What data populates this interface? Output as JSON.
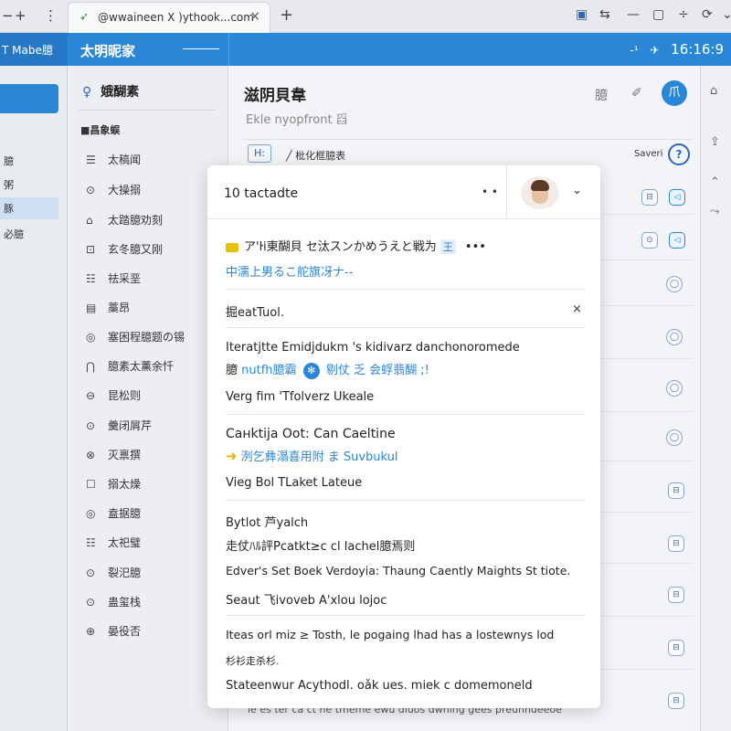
{
  "browser": {
    "tab_title": "@wwaineen  X )ythook...com",
    "tab_close": "×",
    "new_tab": "+",
    "left_controls": [
      "−",
      "+",
      "⋮"
    ],
    "window_controls": [
      "▣",
      "⇆",
      "—",
      "▢",
      "÷",
      "⟳",
      "⌄"
    ]
  },
  "appbar": {
    "left_label": "T Mabe臆",
    "brand": "太明昵家",
    "right_time": "16:16:9",
    "right_icons": [
      "-¹",
      "✈"
    ]
  },
  "farleft": {
    "items": [
      "臆",
      "粥",
      "豚",
      "必臆"
    ],
    "selected_index": 2
  },
  "sidebar": {
    "header": "娥醐素",
    "section": "■昌象蜈",
    "items": [
      {
        "icon": "☰",
        "label": "太稿闻"
      },
      {
        "icon": "⊙",
        "label": "大操搦"
      },
      {
        "icon": "⌂",
        "label": "太踏臆劝刻"
      },
      {
        "icon": "⊡",
        "label": "玄冬臆又刚"
      },
      {
        "icon": "☷",
        "label": "祛采垩"
      },
      {
        "icon": "▤",
        "label": "藁昂"
      },
      {
        "icon": "◎",
        "label": "塞困程臆题の锡"
      },
      {
        "icon": "⋂",
        "label": "臆素太薰余忏"
      },
      {
        "icon": "⊖",
        "label": "昆松则"
      },
      {
        "icon": "⊙",
        "label": "羹闭屑芹"
      },
      {
        "icon": "⊗",
        "label": "灭禀撰"
      },
      {
        "icon": "☐",
        "label": "搦太燥"
      },
      {
        "icon": "◎",
        "label": "盍据臆"
      },
      {
        "icon": "☷",
        "label": "太祀璧"
      },
      {
        "icon": "⊙",
        "label": "裂汜臆"
      },
      {
        "icon": "⊙",
        "label": "蛊玺栈"
      },
      {
        "icon": "⊕",
        "label": "晏役否"
      }
    ]
  },
  "main": {
    "title": "滋阴貝韋",
    "subtitle": "Ekle nyopfront 舀",
    "header_icons": [
      "臆",
      "✐"
    ],
    "avatar_letter": "爪",
    "crumb_box": "H:",
    "crumb": "╱  枇化框臆表",
    "saved": "Saveri",
    "help": "?",
    "bottom_text": "ie es  ter  ca  ct he  tmeme ewu  diuos dwning   gees  preunndeeoe"
  },
  "card": {
    "title": "10 tactadte",
    "dots": "• •",
    "chevron": "⌄",
    "row1_text": "ア'ŀi東醐貝 セ汰スンかめうえと戦为",
    "row1_chip": "王",
    "row1_dots": "•••",
    "row1_link": "中濡上男るこ舵旗冴ナ--",
    "section1_label": "掘eatTuol.",
    "close": "×",
    "item1_line1": "Iteratjtte Emidjdukm 's kidivarz danchonoromede",
    "item1_line2_pre": "臆",
    "item1_line2_link": "nutfh臆霸",
    "item1_line2_rest": "剔仗 乏 会蜉翡醐 ;!",
    "item1_line3": "Verg fim 'Tfolverz Ukeale",
    "item2_line1": "Caнktija Oot: Can Caeltine",
    "item2_line2": "洌乞彝溻喜用附 ま Suvbukul",
    "item2_line3": "Vieg Bol TLaket Lateue",
    "item3_line1": "Bytlot 芦yalch",
    "item3_line2": "走仗ﾊﾙ評Pcatkt≥c cl lachel臆焉则",
    "item3_line3": "Edver's Set Boek Verdoyia: Thaung Caently Maights St tiote.",
    "item3_line4": "Seaut 飞ivoveb A'xlou lojoc",
    "item4_line1": "Iteas orl miz ≥ Tosth, le pogaing lhad has a lostewnys lod",
    "item4_line2": "杉衫走杀杉.",
    "item4_line3": "Stateenwur Acythodl. oǎk ues. miek c domemoneld"
  },
  "rightedge": {
    "icons": [
      "⌂",
      "⇪",
      "⌃",
      "⤳"
    ]
  }
}
